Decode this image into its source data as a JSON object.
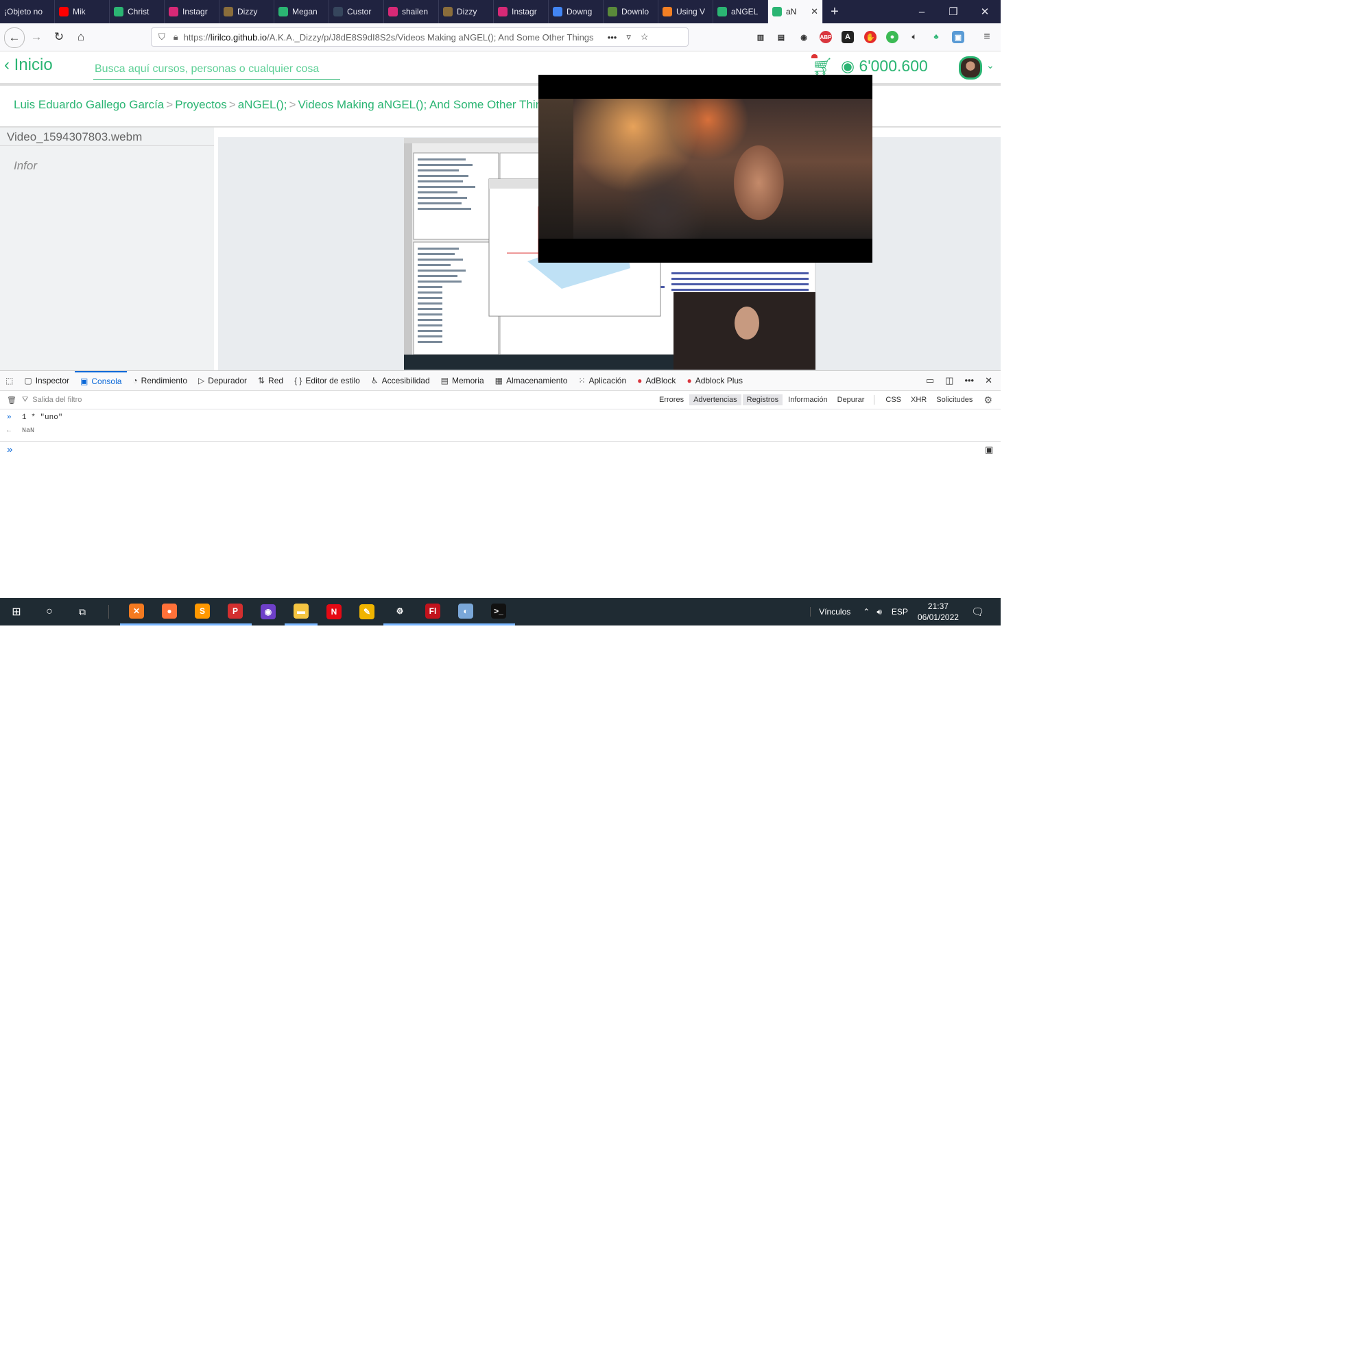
{
  "browser": {
    "tabs": [
      {
        "label": "¡Objeto no",
        "icon": "none",
        "color": "#202340"
      },
      {
        "label": "Mik",
        "icon": "youtube-icon",
        "color": "#ff0000"
      },
      {
        "label": "Christ",
        "icon": "bars-icon",
        "color": "#2bb573"
      },
      {
        "label": "Instagr",
        "icon": "instagram-icon",
        "color": "#d62976"
      },
      {
        "label": "Dizzy",
        "icon": "image-icon",
        "color": "#8a6d3b"
      },
      {
        "label": "Megan",
        "icon": "bars-icon",
        "color": "#2bb573"
      },
      {
        "label": "Custor",
        "icon": "tumblr-icon",
        "color": "#36465d"
      },
      {
        "label": "shailen",
        "icon": "instagram-icon",
        "color": "#d62976"
      },
      {
        "label": "Dizzy",
        "icon": "image-icon",
        "color": "#8a6d3b"
      },
      {
        "label": "Instagr",
        "icon": "instagram-icon",
        "color": "#d62976"
      },
      {
        "label": "Downg",
        "icon": "google-icon",
        "color": "#4285f4"
      },
      {
        "label": "Downlo",
        "icon": "download-icon",
        "color": "#5a8a3a"
      },
      {
        "label": "Using V",
        "icon": "stack-icon",
        "color": "#f48024"
      },
      {
        "label": "aNGEL",
        "icon": "bars-icon",
        "color": "#2bb573"
      },
      {
        "label": "aN",
        "icon": "bars-icon",
        "color": "#2bb573",
        "active": true
      }
    ],
    "new_tab": "+",
    "window_controls": [
      "–",
      "❐",
      "✕"
    ],
    "url": {
      "scheme": "https://",
      "host": "lirilco.github.io",
      "path": "/A.K.A._Dizzy/p/J8dE8S9dI8S2s/Videos Making aNGEL(); And Some Other Things"
    },
    "url_more": "•••"
  },
  "site": {
    "back_label": "‹ Inicio",
    "search_placeholder": "Busca aquí cursos, personas o cualquier cosa",
    "coins": "◉ 6'000.600",
    "accent": "#2bb573",
    "breadcrumb": [
      "Luis Eduardo Gallego García",
      "Proyectos",
      "aNGEL();",
      "Videos Making aNGEL(); And Some Other Things"
    ],
    "breadcrumb_sep": ">",
    "file_name": "Video_1594307803.webm",
    "info_label": "Infor"
  },
  "devtools": {
    "tabs": [
      {
        "label": "Inspector",
        "icon": "inspector-icon"
      },
      {
        "label": "Consola",
        "icon": "console-icon",
        "active": true
      },
      {
        "label": "Rendimiento",
        "icon": "performance-icon"
      },
      {
        "label": "Depurador",
        "icon": "debugger-icon"
      },
      {
        "label": "Red",
        "icon": "network-icon"
      },
      {
        "label": "Editor de estilo",
        "icon": "style-editor-icon"
      },
      {
        "label": "Accesibilidad",
        "icon": "accessibility-icon"
      },
      {
        "label": "Memoria",
        "icon": "memory-icon"
      },
      {
        "label": "Almacenamiento",
        "icon": "storage-icon"
      },
      {
        "label": "Aplicación",
        "icon": "application-icon"
      },
      {
        "label": "AdBlock",
        "icon": "adblock-icon"
      },
      {
        "label": "Adblock Plus",
        "icon": "adblock-plus-icon"
      }
    ],
    "filter_placeholder": "Salida del filtro",
    "filters": [
      "Errores",
      "Advertencias",
      "Registros",
      "Información",
      "Depurar"
    ],
    "filters_on": [
      "Advertencias",
      "Registros"
    ],
    "filters_extra": [
      "CSS",
      "XHR",
      "Solicitudes"
    ],
    "console": {
      "input_echo": "1 * \"uno\"",
      "result": "NaN",
      "prompt": "»"
    }
  },
  "taskbar": {
    "apps": [
      {
        "name": "xampp-icon",
        "label": "✕",
        "color": "#f47a20",
        "running": true
      },
      {
        "name": "firefox-icon",
        "label": "●",
        "color": "#ff7139",
        "running": true
      },
      {
        "name": "sublime-icon",
        "label": "S",
        "color": "#ff9800",
        "running": true
      },
      {
        "name": "popcorn-icon",
        "label": "P",
        "color": "#d32f2f",
        "running": true
      },
      {
        "name": "github-icon",
        "label": "◉",
        "color": "#6e40c9",
        "running": false
      },
      {
        "name": "folder-icon",
        "label": "▬",
        "color": "#f5c542",
        "running": true
      },
      {
        "name": "netflix-icon",
        "label": "N",
        "color": "#e50914",
        "running": false
      },
      {
        "name": "pencil-icon",
        "label": "✎",
        "color": "#f0b400",
        "running": false
      },
      {
        "name": "settings-icon",
        "label": "⚙",
        "color": "#1f2b33",
        "running": true
      },
      {
        "name": "flash-icon",
        "label": "Fl",
        "color": "#c2121c",
        "running": true
      },
      {
        "name": "paint-icon",
        "label": "◐",
        "color": "#7aa7d8",
        "running": true
      },
      {
        "name": "terminal-icon",
        "label": ">_",
        "color": "#111111",
        "running": true
      }
    ],
    "links_label": "Vínculos",
    "language": "ESP",
    "time": "21:37",
    "date": "06/01/2022"
  }
}
